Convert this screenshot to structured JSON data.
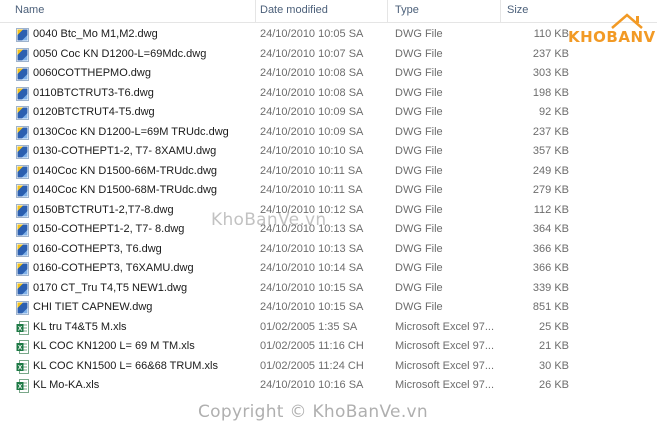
{
  "columns": {
    "name": "Name",
    "date_modified": "Date modified",
    "type": "Type",
    "size": "Size"
  },
  "sort_indicator": "^",
  "files": [
    {
      "name": "0040 Btc_Mo M1,M2.dwg",
      "date": "24/10/2010 10:05 SA",
      "type": "DWG File",
      "size": "110 KB",
      "icon": "dwg-file-icon"
    },
    {
      "name": "0050 Coc KN D1200-L=69Mdc.dwg",
      "date": "24/10/2010 10:07 SA",
      "type": "DWG File",
      "size": "237 KB",
      "icon": "dwg-file-icon"
    },
    {
      "name": "0060COTTHEPMO.dwg",
      "date": "24/10/2010 10:08 SA",
      "type": "DWG File",
      "size": "303 KB",
      "icon": "dwg-file-icon"
    },
    {
      "name": "0110BTCTRUT3-T6.dwg",
      "date": "24/10/2010 10:08 SA",
      "type": "DWG File",
      "size": "198 KB",
      "icon": "dwg-file-icon"
    },
    {
      "name": "0120BTCTRUT4-T5.dwg",
      "date": "24/10/2010 10:09 SA",
      "type": "DWG File",
      "size": "92 KB",
      "icon": "dwg-file-icon"
    },
    {
      "name": "0130Coc KN D1200-L=69M TRUdc.dwg",
      "date": "24/10/2010 10:09 SA",
      "type": "DWG File",
      "size": "237 KB",
      "icon": "dwg-file-icon"
    },
    {
      "name": "0130-COTHEPT1-2, T7- 8XAMU.dwg",
      "date": "24/10/2010 10:10 SA",
      "type": "DWG File",
      "size": "357 KB",
      "icon": "dwg-file-icon"
    },
    {
      "name": "0140Coc KN D1500-66M-TRUdc.dwg",
      "date": "24/10/2010 10:11 SA",
      "type": "DWG File",
      "size": "249 KB",
      "icon": "dwg-file-icon"
    },
    {
      "name": "0140Coc KN D1500-68M-TRUdc.dwg",
      "date": "24/10/2010 10:11 SA",
      "type": "DWG File",
      "size": "279 KB",
      "icon": "dwg-file-icon"
    },
    {
      "name": "0150BTCTRUT1-2,T7-8.dwg",
      "date": "24/10/2010 10:12 SA",
      "type": "DWG File",
      "size": "112 KB",
      "icon": "dwg-file-icon"
    },
    {
      "name": "0150-COTHEPT1-2, T7- 8.dwg",
      "date": "24/10/2010 10:13 SA",
      "type": "DWG File",
      "size": "364 KB",
      "icon": "dwg-file-icon"
    },
    {
      "name": "0160-COTHEPT3, T6.dwg",
      "date": "24/10/2010 10:13 SA",
      "type": "DWG File",
      "size": "366 KB",
      "icon": "dwg-file-icon"
    },
    {
      "name": "0160-COTHEPT3, T6XAMU.dwg",
      "date": "24/10/2010 10:14 SA",
      "type": "DWG File",
      "size": "366 KB",
      "icon": "dwg-file-icon"
    },
    {
      "name": "0170 CT_Tru T4,T5  NEW1.dwg",
      "date": "24/10/2010 10:15 SA",
      "type": "DWG File",
      "size": "339 KB",
      "icon": "dwg-file-icon"
    },
    {
      "name": "CHI TIET CAPNEW.dwg",
      "date": "24/10/2010 10:15 SA",
      "type": "DWG File",
      "size": "851 KB",
      "icon": "dwg-file-icon"
    },
    {
      "name": "KL  tru T4&T5 M.xls",
      "date": "01/02/2005 1:35 SA",
      "type": "Microsoft Excel 97...",
      "size": "25 KB",
      "icon": "excel-file-icon"
    },
    {
      "name": "KL COC KN1200 L= 69 M TM.xls",
      "date": "01/02/2005 11:16 CH",
      "type": "Microsoft Excel 97...",
      "size": "21 KB",
      "icon": "excel-file-icon"
    },
    {
      "name": "KL COC KN1500 L= 66&68 TRUM.xls",
      "date": "01/02/2005 11:24 CH",
      "type": "Microsoft Excel 97...",
      "size": "30 KB",
      "icon": "excel-file-icon"
    },
    {
      "name": "KL Mo-KA.xls",
      "date": "24/10/2010 10:16 SA",
      "type": "Microsoft Excel 97...",
      "size": "26 KB",
      "icon": "excel-file-icon"
    }
  ],
  "watermarks": {
    "logo": "KHOBANVE",
    "middle": "KhoBanVe.vn",
    "bottom": "Copyright © KhoBanVe.vn"
  },
  "colors": {
    "header_text": "#4c607a",
    "muted_text": "#6d6d6d",
    "dwg_blue": "#2b5fb0",
    "dwg_yellow": "#f3c11b",
    "excel_green": "#1d7a45",
    "logo_orange": "#f29a25"
  }
}
